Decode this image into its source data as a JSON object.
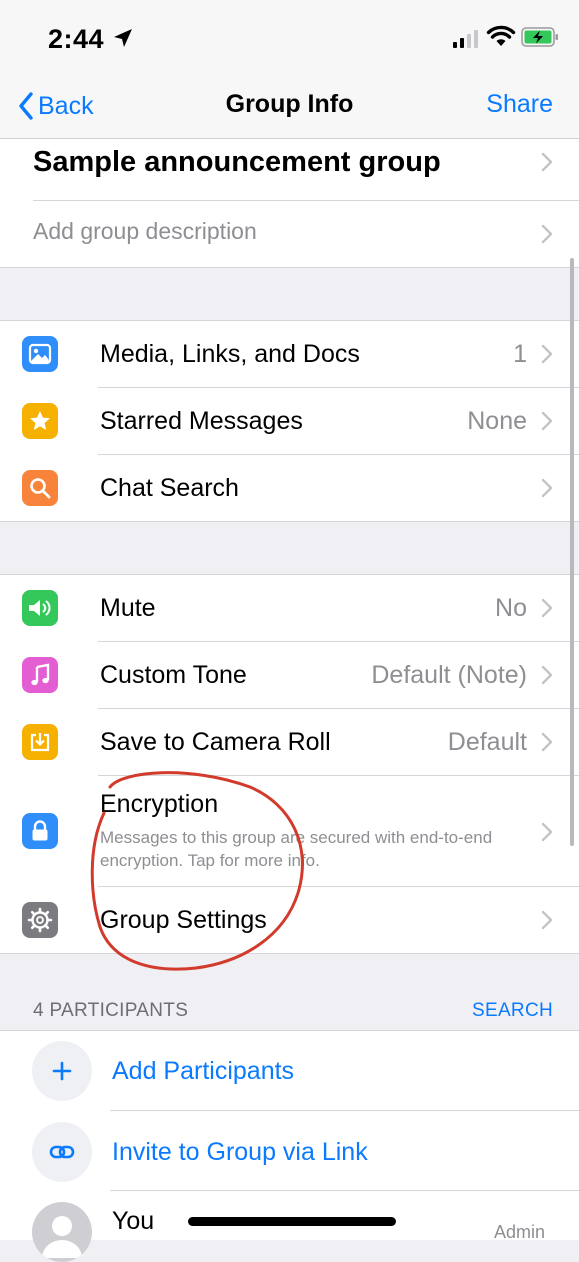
{
  "status_bar": {
    "time": "2:44"
  },
  "nav": {
    "back_label": "Back",
    "title": "Group Info",
    "share_label": "Share"
  },
  "group": {
    "name": "Sample announcement group",
    "description_placeholder": "Add group description"
  },
  "section1": {
    "items": [
      {
        "label": "Media, Links, and Docs",
        "value": "1",
        "icon": "photo-icon",
        "color": "#2f8ef9"
      },
      {
        "label": "Starred Messages",
        "value": "None",
        "icon": "star-icon",
        "color": "#f6b100"
      },
      {
        "label": "Chat Search",
        "value": "",
        "icon": "search-icon",
        "color": "#f8833a"
      }
    ]
  },
  "section2": {
    "items": [
      {
        "label": "Mute",
        "value": "No",
        "icon": "speaker-icon",
        "color": "#34c759"
      },
      {
        "label": "Custom Tone",
        "value": "Default (Note)",
        "icon": "music-note-icon",
        "color": "#e35ed3"
      },
      {
        "label": "Save to Camera Roll",
        "value": "Default",
        "icon": "download-icon",
        "color": "#f6b100"
      },
      {
        "label": "Encryption",
        "subtitle": "Messages to this group are secured with end-to-end encryption. Tap for more info.",
        "icon": "lock-icon",
        "color": "#2f8ef9"
      },
      {
        "label": "Group Settings",
        "value": "",
        "icon": "gear-icon",
        "color": "#7c7c80"
      }
    ]
  },
  "participants": {
    "header": "4 PARTICIPANTS",
    "search_label": "SEARCH",
    "add_label": "Add Participants",
    "invite_label": "Invite to Group via Link",
    "members": [
      {
        "name": "You",
        "role": "Admin"
      }
    ]
  },
  "annotation": {
    "color": "#d23a2c"
  }
}
